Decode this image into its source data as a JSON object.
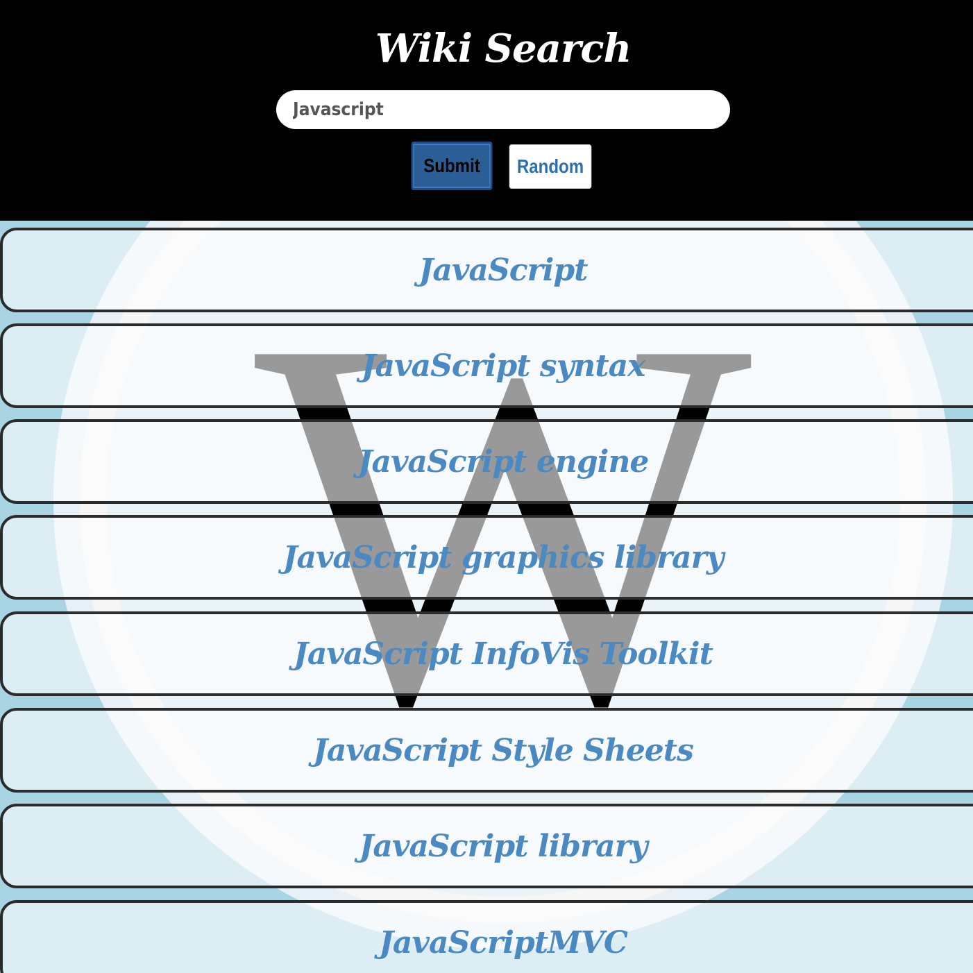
{
  "header": {
    "title": "Wiki Search",
    "search_value": "Javascript",
    "submit_label": "Submit",
    "random_label": "Random"
  },
  "background": {
    "logo_letter": "W"
  },
  "results": [
    {
      "title": "JavaScript"
    },
    {
      "title": "JavaScript syntax"
    },
    {
      "title": "JavaScript engine"
    },
    {
      "title": "JavaScript graphics library"
    },
    {
      "title": "JavaScript InfoVis Toolkit"
    },
    {
      "title": "JavaScript Style Sheets"
    },
    {
      "title": "JavaScript library"
    },
    {
      "title": "JavaScriptMVC"
    }
  ],
  "colors": {
    "header_bg": "#000000",
    "result_text": "#4a89c2",
    "submit_bg": "#2a5e95",
    "random_text": "#2d6fb1",
    "page_bg": "#a9d4e3"
  }
}
